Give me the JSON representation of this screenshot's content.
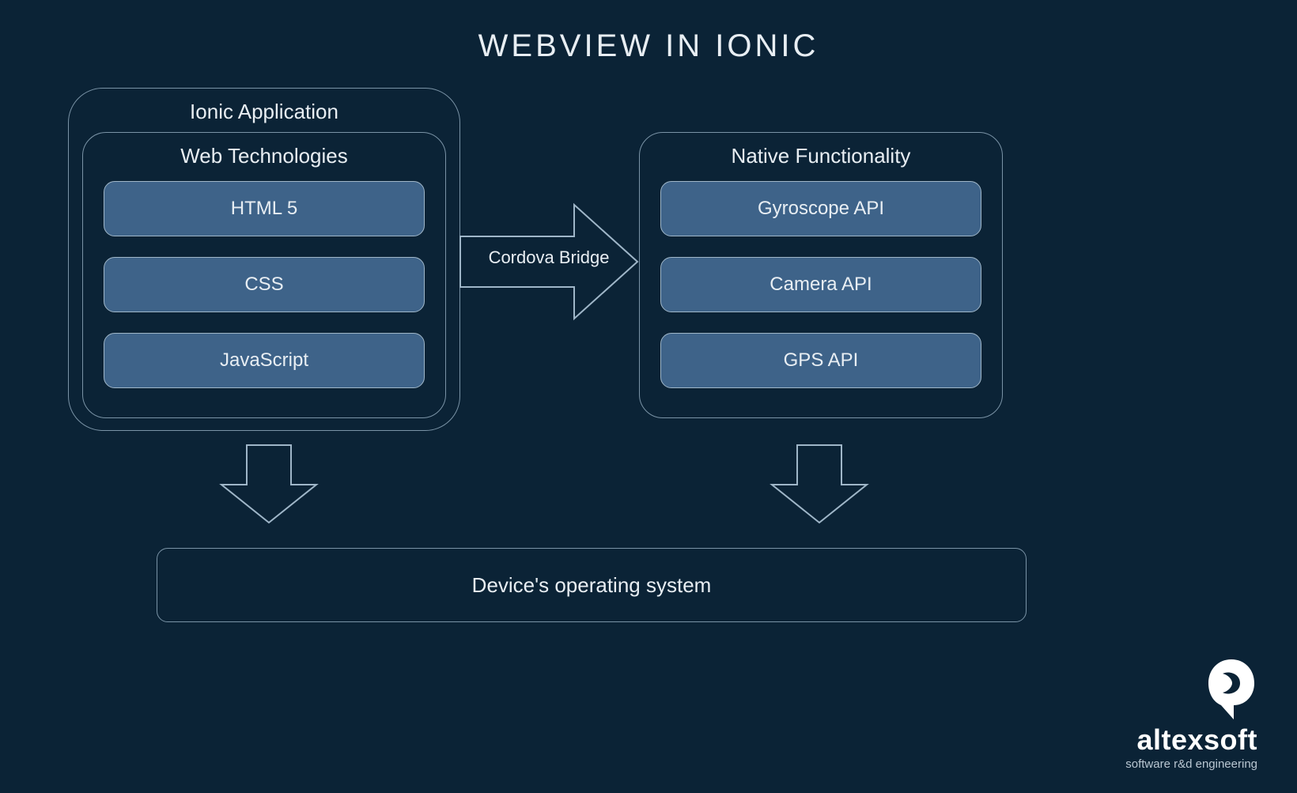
{
  "title": "WEBVIEW IN IONIC",
  "ionicApp": {
    "label": "Ionic Application"
  },
  "webTech": {
    "label": "Web Technologies",
    "items": [
      "HTML 5",
      "CSS",
      "JavaScript"
    ]
  },
  "bridge": {
    "label": "Cordova Bridge"
  },
  "native": {
    "label": "Native Functionality",
    "items": [
      "Gyroscope API",
      "Camera API",
      "GPS API"
    ]
  },
  "os": {
    "label": "Device's operating system"
  },
  "brand": {
    "name": "altexsoft",
    "tagline": "software r&d engineering"
  },
  "colors": {
    "bg": "#0b2336",
    "border": "#7a93a6",
    "pill": "#3e6389",
    "text": "#e8eef3"
  }
}
